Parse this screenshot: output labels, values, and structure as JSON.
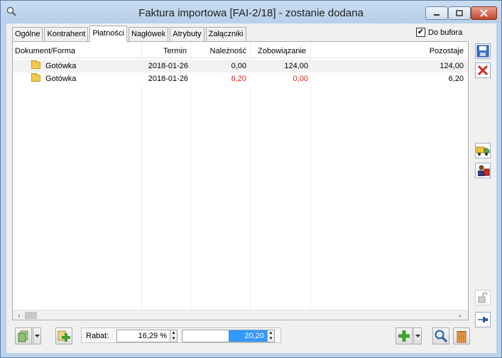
{
  "window": {
    "title": "Faktura importowa [FAI-2/18]  - zostanie dodana"
  },
  "tabs": [
    {
      "label": "Ogólne"
    },
    {
      "label": "Kontrahent"
    },
    {
      "label": "Płatności"
    },
    {
      "label": "Nagłówek"
    },
    {
      "label": "Atrybuty"
    },
    {
      "label": "Załączniki"
    }
  ],
  "active_tab": "Płatności",
  "do_bufora": {
    "label": "Do bufora",
    "checked": "✔"
  },
  "grid": {
    "columns": [
      "Dokument/Forma",
      "Termin",
      "Należność",
      "Zobowiązanie",
      "Pozostaje"
    ],
    "rows": [
      {
        "forma": "Gotówka",
        "termin": "2018-01-26",
        "naleznosc": "0,00",
        "zobowiazanie": "124,00",
        "pozostaje": "124,00"
      },
      {
        "forma": "Gotówka",
        "termin": "2018-01-26",
        "naleznosc": "6,20",
        "zobowiazanie": "0,00",
        "pozostaje": "6,20"
      }
    ]
  },
  "scroll": {
    "left": "‹",
    "right": "›"
  },
  "rabat": {
    "label": "Rabat:",
    "percent": "16,29 %",
    "amount": "20,20"
  },
  "colors": {
    "accent_red": "#e81b1b",
    "selection": "#3399ff"
  },
  "icons": {
    "save": "save-icon",
    "cancel": "cancel-icon",
    "truck": "truck-icon",
    "people": "contractor-icon",
    "lock": "lock-icon",
    "pin": "pin-icon",
    "add": "add-icon",
    "search": "search-icon",
    "delete": "trash-icon"
  }
}
